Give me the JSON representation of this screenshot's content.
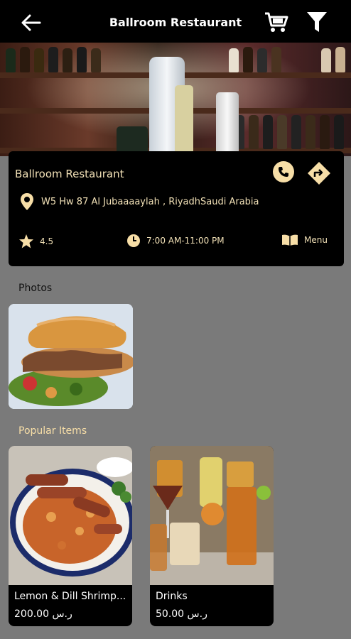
{
  "header": {
    "title": "Ballroom Restaurant",
    "back_icon": "arrow-left-icon",
    "cart_icon": "cart-icon",
    "filter_icon": "filter-icon"
  },
  "restaurant": {
    "name": "Ballroom Restaurant",
    "address": "W5 Hw 87 Al Jubaaaaylah , RiyadhSaudi Arabia",
    "rating": "4.5",
    "hours": "7:00 AM-11:00 PM",
    "menu_label": "Menu"
  },
  "sections": {
    "photos": "Photos",
    "popular": "Popular Items"
  },
  "popular_items": [
    {
      "name": "Lemon & Dill Shrimp...",
      "price": "200.00 ر.س"
    },
    {
      "name": "Drinks",
      "price": "50.00 ر.س"
    }
  ],
  "colors": {
    "accent": "#f7dea7",
    "background": "#7a7a7a",
    "card": "#000000"
  }
}
